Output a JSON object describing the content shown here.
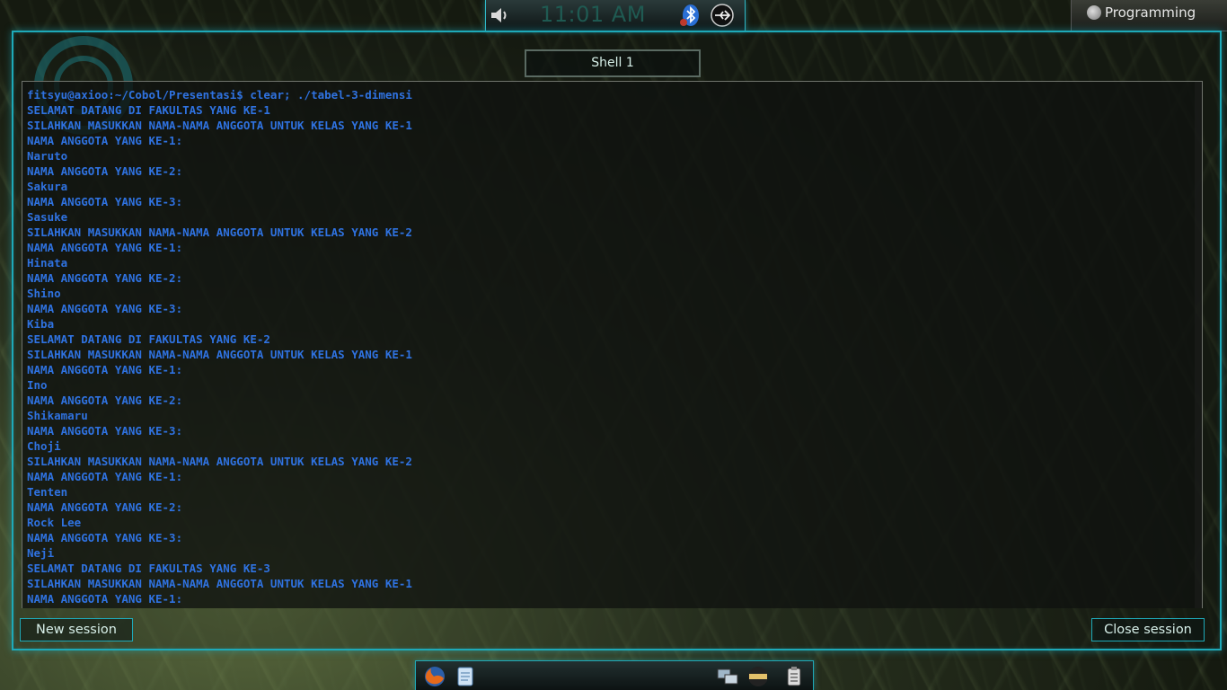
{
  "top_panel": {
    "clock": "11:01 AM",
    "icons": [
      "speaker-icon",
      "bluetooth-icon",
      "usb-network-icon"
    ]
  },
  "activity": {
    "label": "Programming",
    "icon": "activity-icon"
  },
  "window": {
    "tab_label": "Shell 1",
    "new_session_label": "New session",
    "close_session_label": "Close session"
  },
  "terminal": {
    "lines": [
      "fitsyu@axioo:~/Cobol/Presentasi$ clear; ./tabel-3-dimensi",
      "SELAMAT DATANG DI FAKULTAS YANG KE-1",
      "SILAHKAN MASUKKAN NAMA-NAMA ANGGOTA UNTUK KELAS YANG KE-1",
      "NAMA ANGGOTA YANG KE-1:",
      "Naruto",
      "NAMA ANGGOTA YANG KE-2:",
      "Sakura",
      "NAMA ANGGOTA YANG KE-3:",
      "Sasuke",
      "SILAHKAN MASUKKAN NAMA-NAMA ANGGOTA UNTUK KELAS YANG KE-2",
      "NAMA ANGGOTA YANG KE-1:",
      "Hinata",
      "NAMA ANGGOTA YANG KE-2:",
      "Shino",
      "NAMA ANGGOTA YANG KE-3:",
      "Kiba",
      "SELAMAT DATANG DI FAKULTAS YANG KE-2",
      "SILAHKAN MASUKKAN NAMA-NAMA ANGGOTA UNTUK KELAS YANG KE-1",
      "NAMA ANGGOTA YANG KE-1:",
      "Ino",
      "NAMA ANGGOTA YANG KE-2:",
      "Shikamaru",
      "NAMA ANGGOTA YANG KE-3:",
      "Choji",
      "SILAHKAN MASUKKAN NAMA-NAMA ANGGOTA UNTUK KELAS YANG KE-2",
      "NAMA ANGGOTA YANG KE-1:",
      "Tenten",
      "NAMA ANGGOTA YANG KE-2:",
      "Rock Lee",
      "NAMA ANGGOTA YANG KE-3:",
      "Neji",
      "SELAMAT DATANG DI FAKULTAS YANG KE-3",
      "SILAHKAN MASUKKAN NAMA-NAMA ANGGOTA UNTUK KELAS YANG KE-1",
      "NAMA ANGGOTA YANG KE-1:"
    ],
    "text_color": "#2f72e0"
  },
  "dock": {
    "icons": [
      "firefox-icon",
      "notes-icon",
      "network-manager-icon",
      "ninja-icon",
      "clipboard-icon"
    ]
  },
  "colors": {
    "accent": "#1ea9b8"
  }
}
